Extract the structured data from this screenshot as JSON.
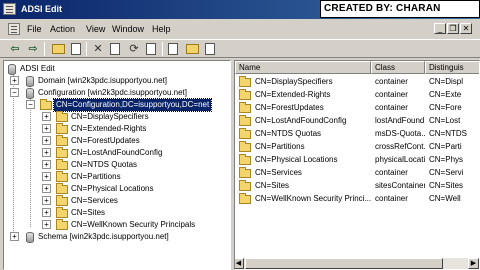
{
  "window": {
    "title": "ADSI Edit"
  },
  "credit": "CREATED BY: CHARAN BAISETTY",
  "menu": {
    "items": [
      "File",
      "Action",
      "View",
      "Window",
      "Help"
    ]
  },
  "mdi_buttons": [
    "_",
    "❐",
    "✕"
  ],
  "toolbar": {
    "buttons": [
      "back-arrow",
      "forward-arrow",
      "up-folder",
      "show-hide-tree",
      "delete",
      "properties",
      "refresh",
      "export-list",
      "help",
      "new-object",
      "console-tree"
    ]
  },
  "tree": {
    "root": "ADSI Edit",
    "domain": "Domain [win2k3pdc.isupportyou.net]",
    "configuration": "Configuration [win2k3pdc.isupportyou.net]",
    "config_node": "CN=Configuration,DC=isupportyou,DC=net",
    "children": [
      "CN=DisplaySpecifiers",
      "CN=Extended-Rights",
      "CN=ForestUpdates",
      "CN=LostAndFoundConfig",
      "CN=NTDS Quotas",
      "CN=Partitions",
      "CN=Physical Locations",
      "CN=Services",
      "CN=Sites",
      "CN=WellKnown Security Principals"
    ],
    "schema": "Schema [win2k3pdc.isupportyou.net]"
  },
  "list": {
    "headers": {
      "name": "Name",
      "class": "Class",
      "dn": "Distinguis"
    },
    "rows": [
      {
        "name": "CN=DisplaySpecifiers",
        "class": "container",
        "dn": "CN=Displ"
      },
      {
        "name": "CN=Extended-Rights",
        "class": "container",
        "dn": "CN=Exte"
      },
      {
        "name": "CN=ForestUpdates",
        "class": "container",
        "dn": "CN=Fore"
      },
      {
        "name": "CN=LostAndFoundConfig",
        "class": "lostAndFound",
        "dn": "CN=Lost"
      },
      {
        "name": "CN=NTDS Quotas",
        "class": "msDS-Quota...",
        "dn": "CN=NTDS"
      },
      {
        "name": "CN=Partitions",
        "class": "crossRefCont...",
        "dn": "CN=Parti"
      },
      {
        "name": "CN=Physical Locations",
        "class": "physicalLocation",
        "dn": "CN=Phys"
      },
      {
        "name": "CN=Services",
        "class": "container",
        "dn": "CN=Servi"
      },
      {
        "name": "CN=Sites",
        "class": "sitesContainer",
        "dn": "CN=Sites"
      },
      {
        "name": "CN=WellKnown Security Princi...",
        "class": "container",
        "dn": "CN=Well"
      }
    ]
  },
  "colors": {
    "titlebar": "#0a246a",
    "selection": "#0a246a",
    "folder": "#f3d56b",
    "chrome": "#d4d0c8"
  }
}
